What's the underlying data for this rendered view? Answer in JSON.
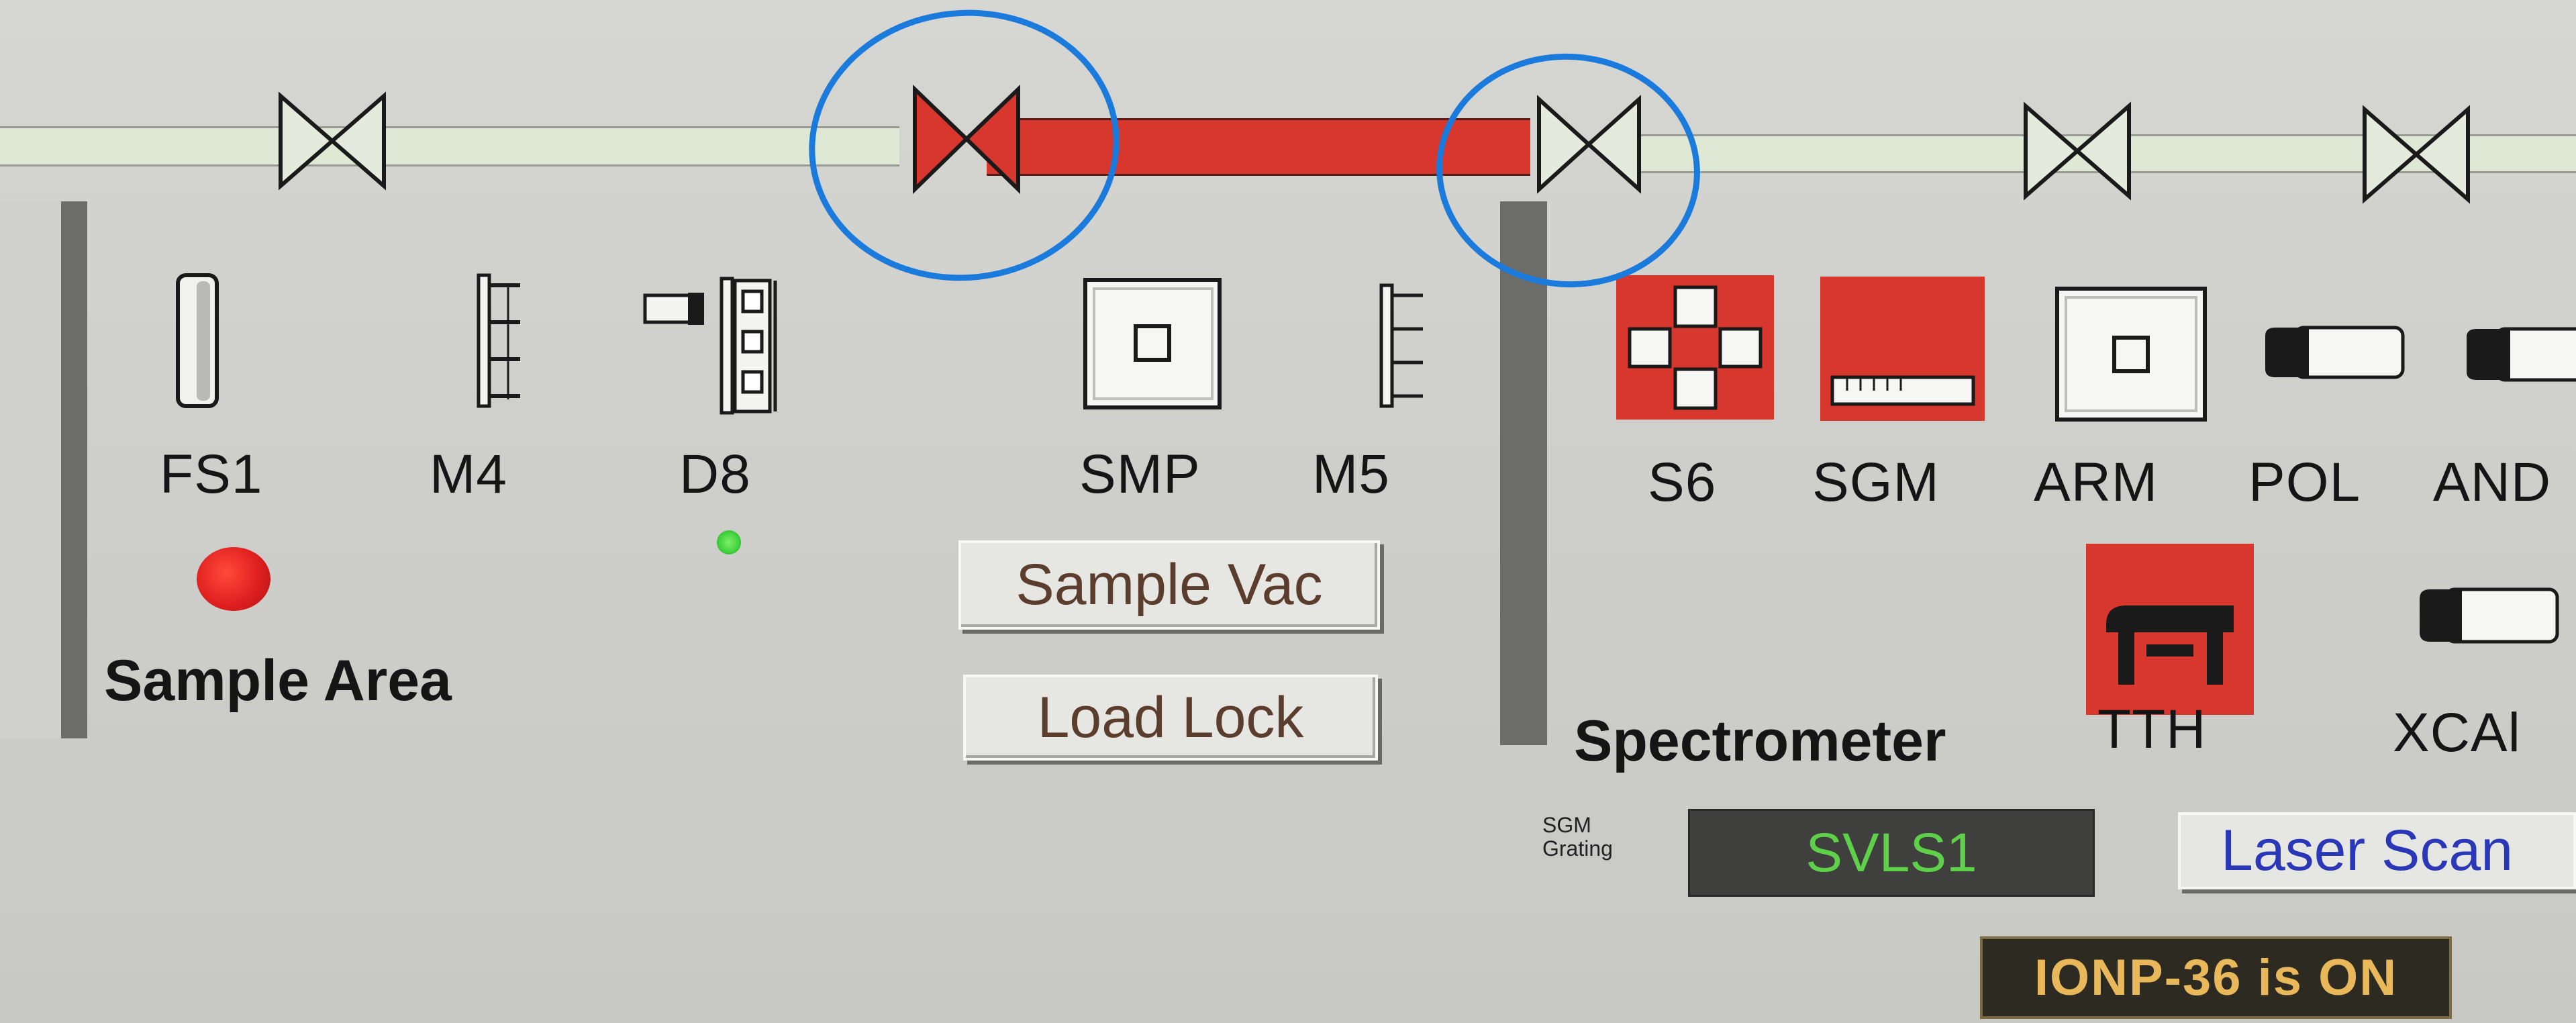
{
  "colors": {
    "valve_closed": "#d8372e",
    "valve_open": "#e4ebdd",
    "pipe_open": "#dfe8d4",
    "lamp_red": "#e02020",
    "lamp_green": "#3fd13a",
    "display_text": "#5fd04a",
    "link_blue": "#2a38b8",
    "status_text": "#e9b85a",
    "annotation_blue": "#1a7bdc"
  },
  "beamline": {
    "valves": [
      {
        "state": "open",
        "icon": "gate-valve-icon"
      },
      {
        "state": "closed",
        "icon": "gate-valve-icon"
      },
      {
        "state": "open",
        "icon": "gate-valve-icon"
      },
      {
        "state": "open",
        "icon": "gate-valve-icon"
      },
      {
        "state": "open",
        "icon": "gate-valve-icon"
      }
    ]
  },
  "sample_area": {
    "title": "Sample Area",
    "devices": [
      {
        "label": "FS1",
        "icon": "fluorescent-screen-icon"
      },
      {
        "label": "M4",
        "icon": "mirror-icon"
      },
      {
        "label": "D8",
        "icon": "diagnostic-icon"
      },
      {
        "label": "SMP",
        "icon": "sample-chamber-icon"
      },
      {
        "label": "M5",
        "icon": "mirror-icon"
      }
    ],
    "buttons": {
      "sample_vac": "Sample Vac",
      "load_lock": "Load Lock"
    }
  },
  "spectrometer": {
    "title": "Spectrometer",
    "devices": [
      {
        "label": "S6",
        "icon": "slit-icon"
      },
      {
        "label": "SGM",
        "icon": "grating-monochromator-icon"
      },
      {
        "label": "ARM",
        "icon": "arm-icon"
      },
      {
        "label": "POL",
        "icon": "polarizer-icon"
      },
      {
        "label": "AND",
        "icon": "detector-icon"
      },
      {
        "label": "TTH",
        "icon": "two-theta-stage-icon"
      },
      {
        "label": "XCAl",
        "icon": "xcal-icon"
      }
    ],
    "grating": {
      "label_line1": "SGM",
      "label_line2": "Grating",
      "value": "SVLS1"
    },
    "laser_scan_button": "Laser Scan",
    "status": "IONP-36 is ON"
  }
}
